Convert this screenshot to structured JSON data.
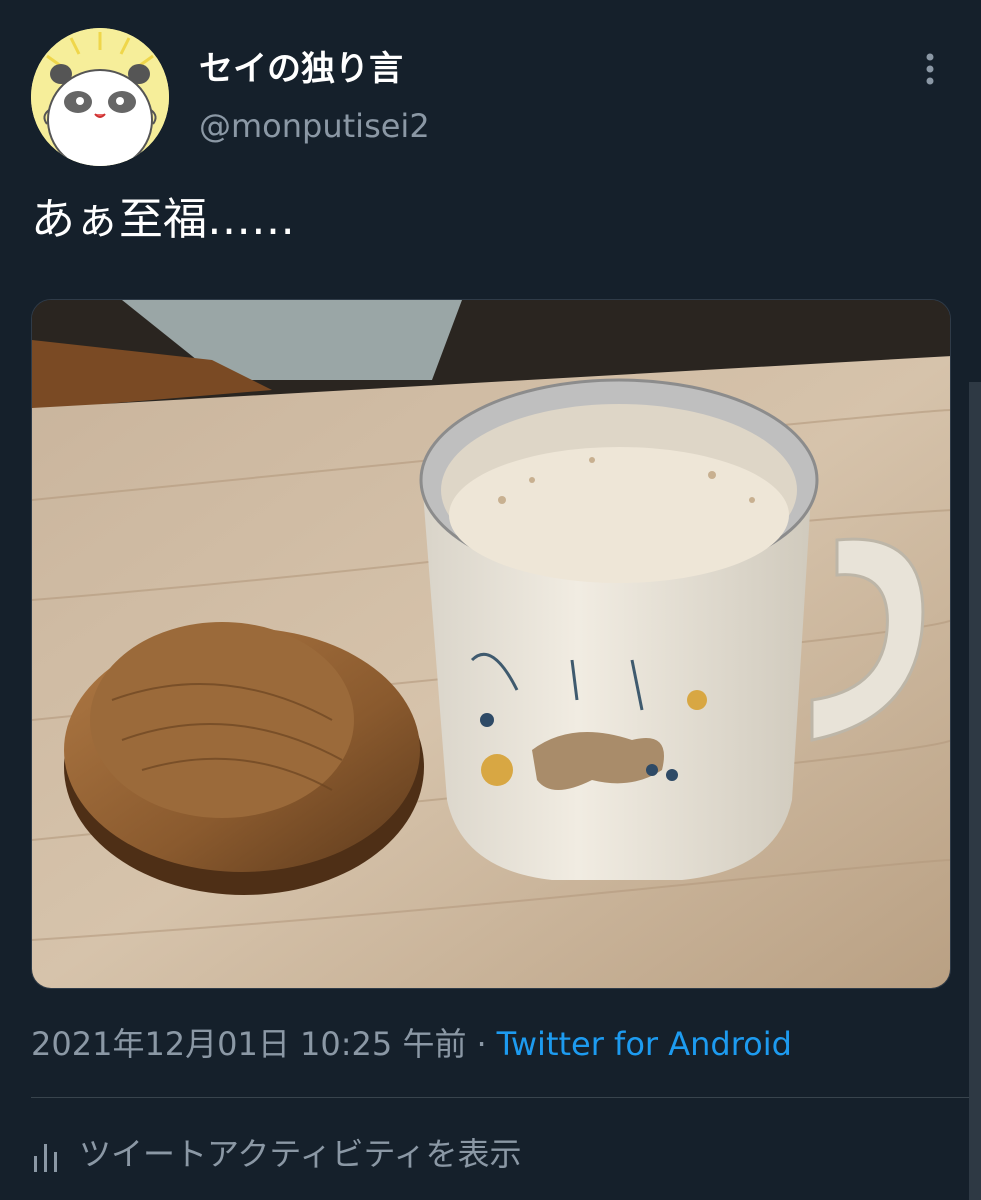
{
  "user": {
    "display_name": "セイの独り言",
    "handle": "@monputisei2"
  },
  "tweet": {
    "text": "あぁ至福……"
  },
  "meta": {
    "timestamp": "2021年12月01日 10:25 午前",
    "separator": "·",
    "source": "Twitter for Android"
  },
  "activity": {
    "label": "ツイートアクティビティを表示",
    "icon": "analytics-icon"
  },
  "icons": {
    "more": "more-vertical-icon"
  },
  "colors": {
    "background": "#15202b",
    "link": "#1d9bf0",
    "secondary_text": "#8b98a5",
    "divider": "#38444d"
  }
}
